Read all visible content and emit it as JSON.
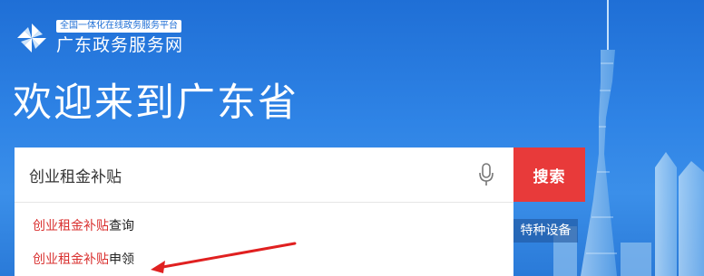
{
  "logo": {
    "tagline": "全国一体化在线政务服务平台",
    "name": "广东政务服务网",
    "icon": "pinwheel-logo"
  },
  "welcome": "欢迎来到广东省",
  "search": {
    "value": "创业租金补贴",
    "button_label": "搜索",
    "mic_icon": "microphone-icon"
  },
  "suggestions": [
    {
      "highlight": "创业租金补贴",
      "rest": "查询"
    },
    {
      "highlight": "创业租金补贴",
      "rest": "申领"
    }
  ],
  "side_tag": "特种设备",
  "colors": {
    "background": "#2f84e6",
    "search_button": "#e83a3a",
    "highlight": "#d9302f",
    "arrow": "#e02020"
  }
}
